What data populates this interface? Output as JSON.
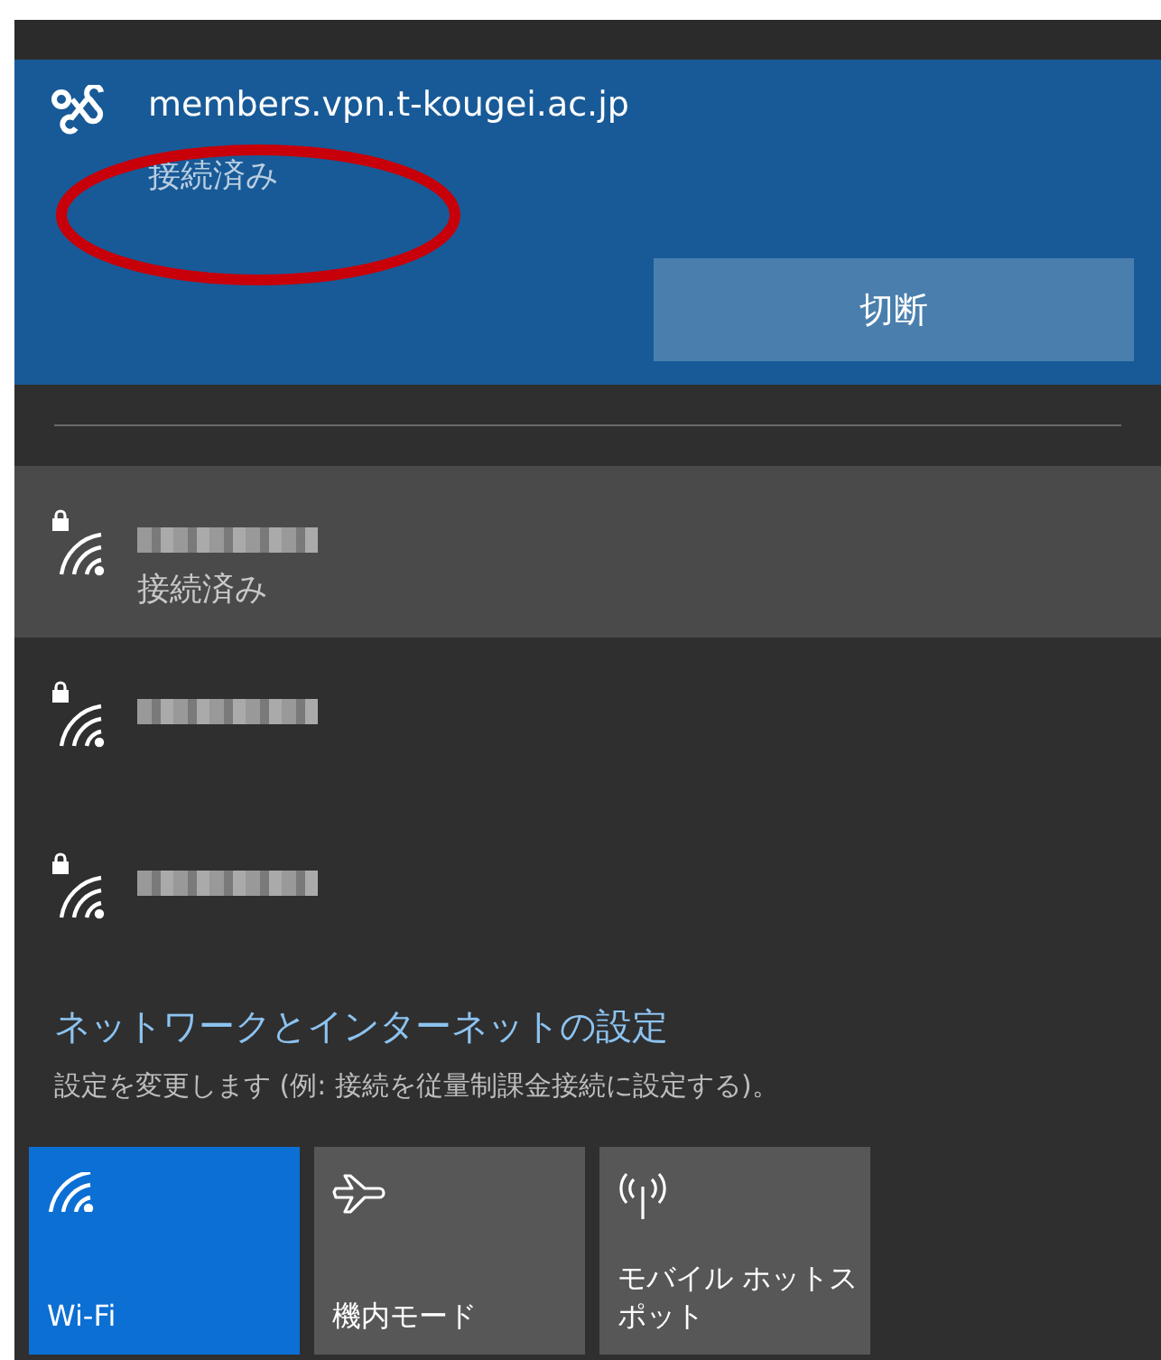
{
  "vpn": {
    "name": "members.vpn.t-kougei.ac.jp",
    "status": "接続済み",
    "button": "切断",
    "annotated": true
  },
  "networks": [
    {
      "status": "接続済み",
      "selected": true,
      "secured": true
    },
    {
      "selected": false,
      "secured": true
    },
    {
      "selected": false,
      "secured": true
    }
  ],
  "settings": {
    "link": "ネットワークとインターネットの設定",
    "description": "設定を変更します (例: 接続を従量制課金接続に設定する)。"
  },
  "tiles": [
    {
      "kind": "wifi",
      "label": "Wi-Fi",
      "on": true
    },
    {
      "kind": "airplane",
      "label": "機内モード",
      "on": false
    },
    {
      "kind": "hotspot",
      "label": "モバイル ホットスポット",
      "on": false
    }
  ]
}
